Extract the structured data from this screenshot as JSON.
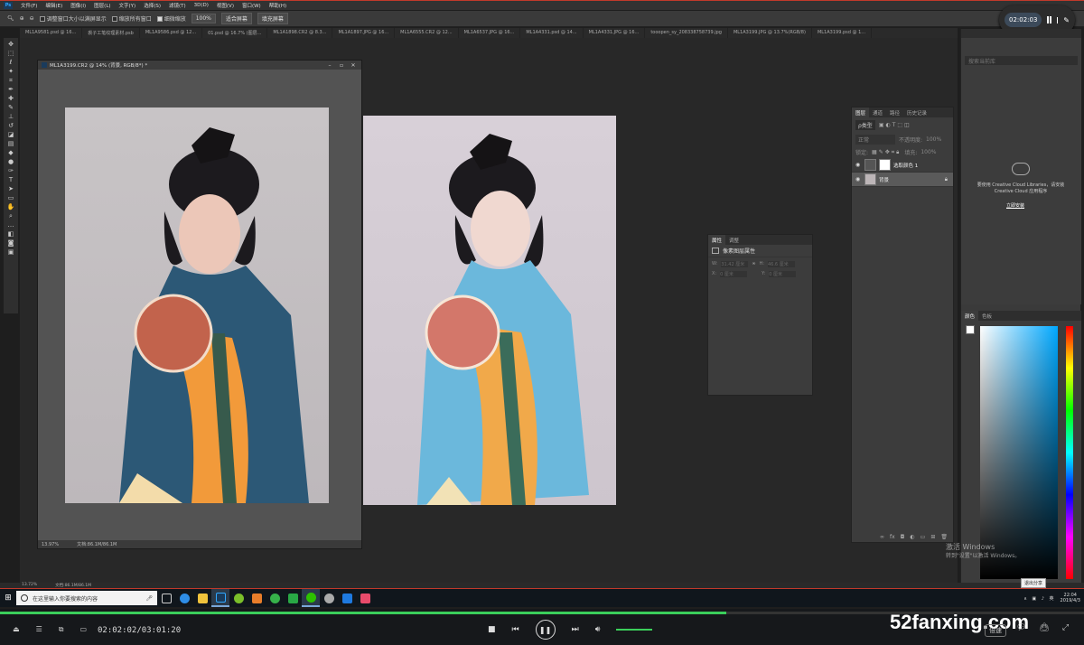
{
  "menu": {
    "items": [
      "文件(F)",
      "编辑(E)",
      "图像(I)",
      "图层(L)",
      "文字(Y)",
      "选择(S)",
      "滤镜(T)",
      "3D(D)",
      "视图(V)",
      "窗口(W)",
      "帮助(H)"
    ]
  },
  "options": {
    "resize_windows": "调整窗口大小以满屏显示",
    "zoom_all": "缩放所有窗口",
    "scrubby_zoom": "细微缩放",
    "zoom_value": "100%",
    "fit_screen": "适合屏幕",
    "fill_screen": "填充屏幕"
  },
  "recorder": {
    "time": "02:02:03"
  },
  "tabs": [
    "ML1A9581.psd @ 16...",
    "裘子工笔纹理素材.psb",
    "ML1A9586.psd @ 12...",
    "01.psd @ 16.7% (图层...",
    "ML1A1898.CR2 @ 8.3...",
    "ML1A1897.JPG @ 16...",
    "ML1A6555.CR2 @ 12...",
    "ML1A6537.JPG @ 16...",
    "ML1A4331.psd @ 14...",
    "ML1A4331.JPG @ 16...",
    "tooopen_sy_208338758739.jpg",
    "ML1A3199.JPG @ 13.7%(RGB/8)",
    "ML1A3199.psd @ 1..."
  ],
  "docwin": {
    "title": "ML1A3199.CR2 @ 14% (背景, RGB/8*) *",
    "zoom": "13.97%",
    "doc": "文档:86.1M/86.1M"
  },
  "layers": {
    "tabs": [
      "图层",
      "通道",
      "路径",
      "历史记录"
    ],
    "kind": "ρ类型",
    "blend": "正常",
    "opacity_label": "不透明度:",
    "opacity": "100%",
    "lock_label": "锁定:",
    "fill_label": "填充:",
    "fill": "100%",
    "items": [
      {
        "name": "选取颜色 1"
      },
      {
        "name": "背景"
      }
    ]
  },
  "props": {
    "tabs": [
      "属性",
      "调整"
    ],
    "title": "像素图层属性",
    "w": "W:",
    "h": "H:",
    "x": "X:",
    "y": "Y:",
    "w_val": "31.42 厘米",
    "h_val": "46.6 厘米",
    "x_val": "0 厘米",
    "y_val": "0 厘米"
  },
  "libs": {
    "search": "搜索当前库",
    "cc_text": "要使用 Creative Cloud Libraries，请安装 Creative Cloud 应用程序",
    "link": "立即安装"
  },
  "color": {
    "tabs": [
      "颜色",
      "色板"
    ]
  },
  "watermark": {
    "line1": "激活 Windows",
    "line2": "转到\"设置\"以激活 Windows。"
  },
  "psstatus": {
    "zoom": "13.72%",
    "doc": "文档:86.1M/86.1M"
  },
  "taskbar": {
    "search_placeholder": "在这里输入你要搜索的内容",
    "time": "22:04",
    "date": "2019/4/3",
    "popup": "退出分享"
  },
  "player": {
    "time": "02:02:02/03:01:20",
    "progress": 0.67,
    "speed": "倍速",
    "brand": "52fanxing.com"
  }
}
